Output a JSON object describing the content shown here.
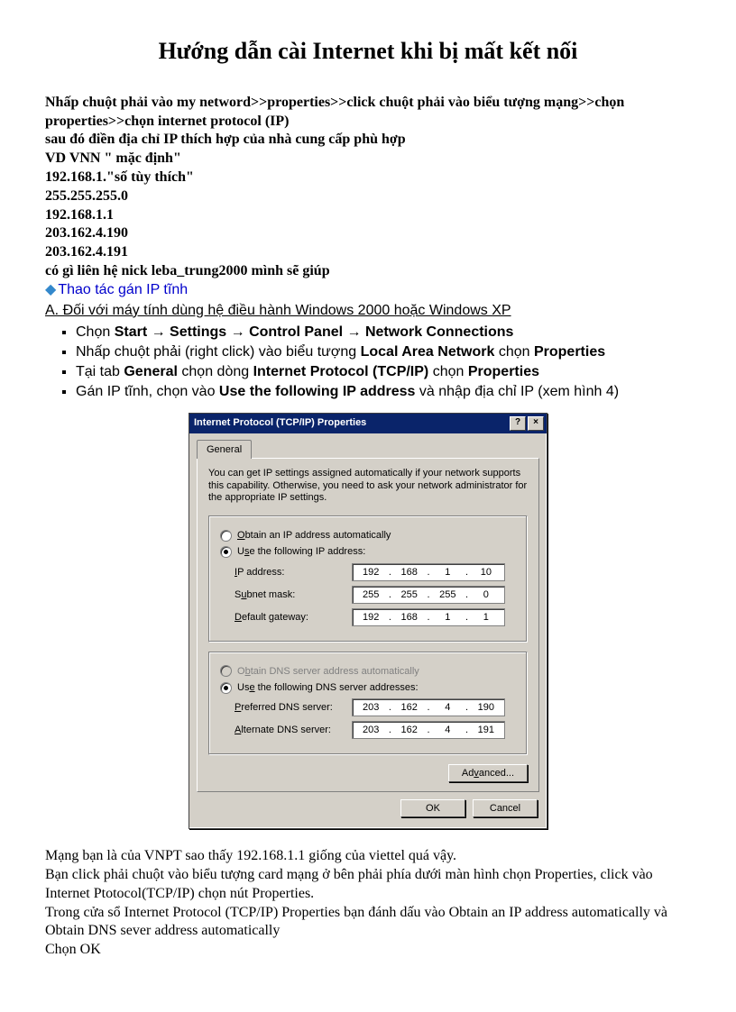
{
  "title": "Hướng dẫn cài Internet khi bị mất kết nối",
  "intro": {
    "l1": "Nhấp chuột phải vào my netword>>properties>>click chuột phải vào biểu tượng mạng>>chọn properties>>chọn internet protocol (IP)",
    "l2": "sau đó điền địa chỉ IP thích hợp của nhà cung cấp phù hợp",
    "l3": "VD VNN \" mặc định\"",
    "l4": "192.168.1.\"số tùy thích\"",
    "l5": "255.255.255.0",
    "l6": "192.168.1.1",
    "l7": "203.162.4.190",
    "l8": "203.162.4.191",
    "l9": "có gì liên hệ nick leba_trung2000 mình sẽ giúp"
  },
  "section_title": "Thao tác gán IP tĩnh",
  "subheading": "A. Đối với máy tính dùng hệ điều hành Windows 2000 hoặc Windows XP",
  "steps": {
    "s1a": "Chọn ",
    "s1b": "Start",
    "s1c": "Settings",
    "s1d": "Control Panel",
    "s1e": "Network Connections",
    "s2a": "Nhấp chuột phải (right click) vào biểu tượng ",
    "s2b": "Local Area Network",
    "s2c": " chọn ",
    "s2d": "Properties",
    "s3a": "Tại tab ",
    "s3b": "General",
    "s3c": " chọn dòng ",
    "s3d": "Internet Protocol (TCP/IP)",
    "s3e": " chọn ",
    "s3f": "Properties",
    "s4a": "Gán IP tĩnh, chọn vào ",
    "s4b": "Use the following IP address",
    "s4c": " và nhập địa chỉ IP (xem hình 4)"
  },
  "dialog": {
    "title": "Internet Protocol (TCP/IP) Properties",
    "tab": "General",
    "desc": "You can get IP settings assigned automatically if your network supports this capability. Otherwise, you need to ask your network administrator for the appropriate IP settings.",
    "radio_auto_ip": "Obtain an IP address automatically",
    "radio_use_ip": "Use the following IP address:",
    "lbl_ip": "IP address:",
    "ip": [
      "192",
      "168",
      "1",
      "10"
    ],
    "lbl_subnet": "Subnet mask:",
    "subnet": [
      "255",
      "255",
      "255",
      "0"
    ],
    "lbl_gateway": "Default gateway:",
    "gateway": [
      "192",
      "168",
      "1",
      "1"
    ],
    "radio_auto_dns": "Obtain DNS server address automatically",
    "radio_use_dns": "Use the following DNS server addresses:",
    "lbl_pref_dns": "Preferred DNS server:",
    "pref_dns": [
      "203",
      "162",
      "4",
      "190"
    ],
    "lbl_alt_dns": "Alternate DNS server:",
    "alt_dns": [
      "203",
      "162",
      "4",
      "191"
    ],
    "btn_adv": "Advanced...",
    "btn_ok": "OK",
    "btn_cancel": "Cancel"
  },
  "bottom": {
    "l1": "Mạng bạn là của VNPT sao thấy 192.168.1.1 giống của viettel quá vậy.",
    "l2": "Bạn click phải chuột vào biểu tượng card mạng ở bên phải phía dưới màn hình chọn Properties, click vào Internet Ptotocol(TCP/IP) chọn nút Properties.",
    "l3": "Trong cửa sổ Internet Protocol (TCP/IP) Properties bạn đánh dấu vào Obtain an IP address automatically và Obtain DNS sever address automatically",
    "l4": "Chọn OK"
  }
}
